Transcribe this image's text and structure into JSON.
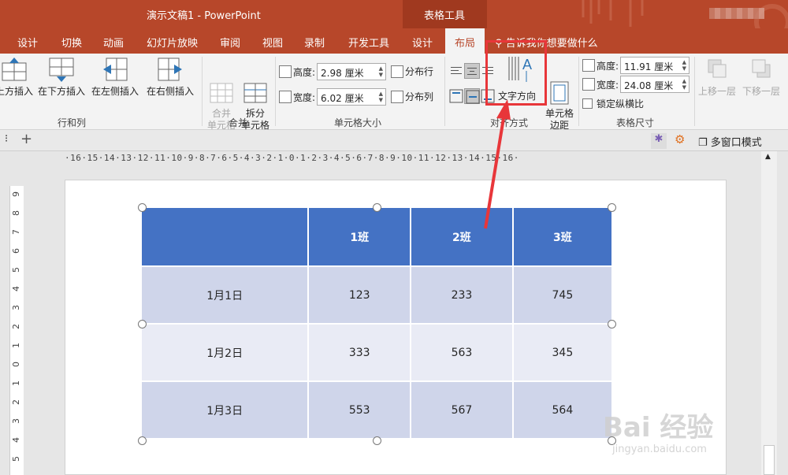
{
  "titlebar": {
    "title": "演示文稿1  -  PowerPoint",
    "context_tab_group": "表格工具"
  },
  "tabs": [
    {
      "label": "设计"
    },
    {
      "label": "切换"
    },
    {
      "label": "动画"
    },
    {
      "label": "幻灯片放映"
    },
    {
      "label": "审阅"
    },
    {
      "label": "视图"
    },
    {
      "label": "录制"
    },
    {
      "label": "开发工具"
    },
    {
      "label": "设计"
    },
    {
      "label": "布局"
    }
  ],
  "tell_me": "告诉我你想要做什么",
  "ribbon": {
    "rows_cols": {
      "insert_above": "上方插入",
      "insert_below": "在下方插入",
      "insert_left": "在左侧插入",
      "insert_right": "在右侧插入",
      "group": "行和列"
    },
    "merge": {
      "merge_cells": "合并\n单元格",
      "split_cells": "拆分\n单元格",
      "group": "合并"
    },
    "cell_size": {
      "height_label": "高度:",
      "height_value": "2.98 厘米",
      "width_label": "宽度:",
      "width_value": "6.02 厘米",
      "distribute_rows": "分布行",
      "distribute_cols": "分布列",
      "group": "单元格大小"
    },
    "alignment": {
      "text_direction": "文字方向",
      "cell_margins": "单元格\n边距",
      "group": "对齐方式"
    },
    "table_size": {
      "height_label": "高度:",
      "height_value": "11.91 厘米",
      "width_label": "宽度:",
      "width_value": "24.08 厘米",
      "lock_ratio": "锁定纵横比",
      "group": "表格尺寸"
    },
    "arrange": {
      "bring_forward": "上移一层",
      "send_backward": "下移一层"
    }
  },
  "subbar": {
    "multi_window": "多窗口模式"
  },
  "ruler_h": "·16·15·14·13·12·11·10·9·8·7·6·5·4·3·2·1·0·1·2·3·4·5·6·7·8·9·10·11·12·13·14·15·16·",
  "table": {
    "header": [
      "",
      "1班",
      "2班",
      "3班"
    ],
    "rows": [
      [
        "1月1日",
        "123",
        "233",
        "745"
      ],
      [
        "1月2日",
        "333",
        "563",
        "345"
      ],
      [
        "1月3日",
        "553",
        "567",
        "564"
      ]
    ]
  },
  "watermark": {
    "brand": "Bai 经验",
    "url": "jingyan.baidu.com"
  },
  "colors": {
    "brand": "#b7472a",
    "table_header": "#4472c4",
    "row_dark": "#cfd5ea",
    "row_light": "#e9ebf5",
    "highlight": "#e8363a"
  }
}
